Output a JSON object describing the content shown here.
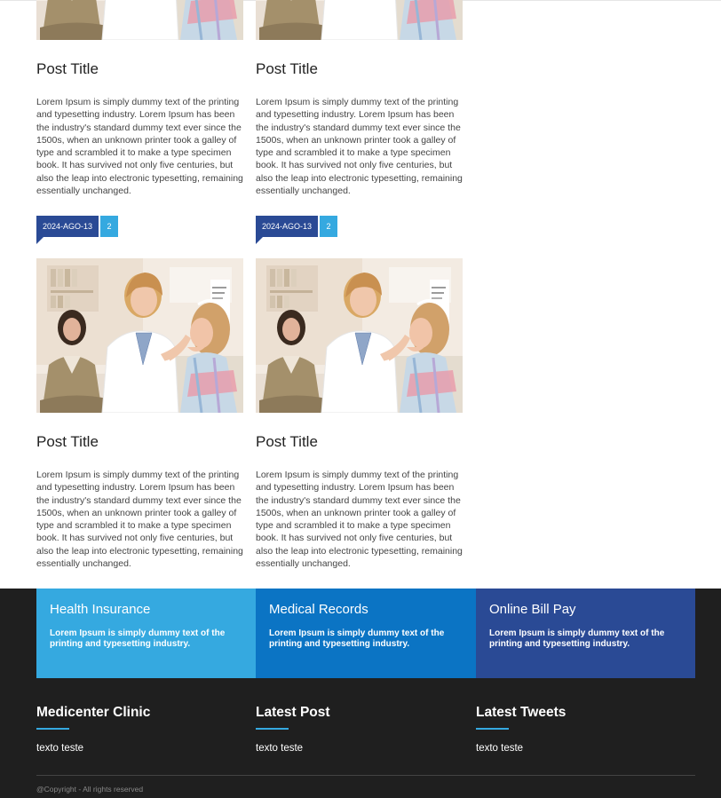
{
  "posts": [
    {
      "title": "Post Title",
      "excerpt": "Lorem Ipsum is simply dummy text of the printing and typesetting industry. Lorem Ipsum has been the industry's standard dummy text ever since the 1500s, when an unknown printer took a galley of type and scrambled it to make a type specimen book. It has survived not only five centuries, but also the leap into electronic typesetting, remaining essentially unchanged.",
      "date": "2024-AGO-13",
      "comments": "2"
    },
    {
      "title": "Post Title",
      "excerpt": "Lorem Ipsum is simply dummy text of the printing and typesetting industry. Lorem Ipsum has been the industry's standard dummy text ever since the 1500s, when an unknown printer took a galley of type and scrambled it to make a type specimen book. It has survived not only five centuries, but also the leap into electronic typesetting, remaining essentially unchanged.",
      "date": "2024-AGO-13",
      "comments": "2"
    },
    {
      "title": "Post Title",
      "excerpt": "Lorem Ipsum is simply dummy text of the printing and typesetting industry. Lorem Ipsum has been the industry's standard dummy text ever since the 1500s, when an unknown printer took a galley of type and scrambled it to make a type specimen book. It has survived not only five centuries, but also the leap into electronic typesetting, remaining essentially unchanged."
    },
    {
      "title": "Post Title",
      "excerpt": "Lorem Ipsum is simply dummy text of the printing and typesetting industry. Lorem Ipsum has been the industry's standard dummy text ever since the 1500s, when an unknown printer took a galley of type and scrambled it to make a type specimen book. It has survived not only five centuries, but also the leap into electronic typesetting, remaining essentially unchanged."
    }
  ],
  "features": [
    {
      "title": "Health Insurance",
      "text": "Lorem Ipsum is simply dummy text of the printing and typesetting industry.",
      "color": "#35a9e0"
    },
    {
      "title": "Medical Records",
      "text": "Lorem Ipsum is simply dummy text of the printing and typesetting industry.",
      "color": "#0b74c4"
    },
    {
      "title": "Online Bill Pay",
      "text": "Lorem Ipsum is simply dummy text of the printing and typesetting industry.",
      "color": "#2a4a95"
    }
  ],
  "footer": {
    "columns": [
      {
        "heading": "Medicenter Clinic",
        "text": "texto teste"
      },
      {
        "heading": "Latest Post",
        "text": "texto teste"
      },
      {
        "heading": "Latest Tweets",
        "text": "texto teste"
      }
    ],
    "copyright": "@Copyright - All rights reserved"
  },
  "colors": {
    "accent": "#35a9e0",
    "primary_dark": "#2a4a95",
    "footer_bg": "#1f1f1f"
  },
  "images": {
    "post_image": "doctor-examining-child-photo"
  }
}
